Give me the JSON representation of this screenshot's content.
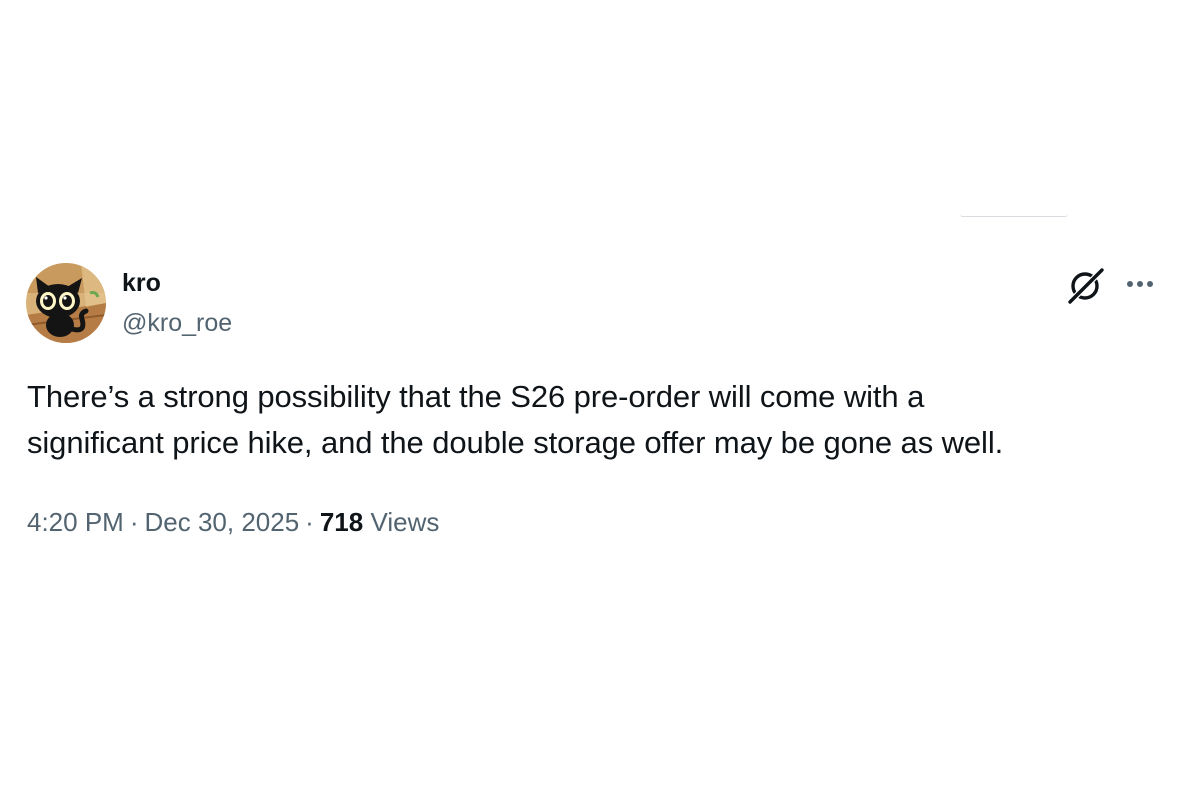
{
  "tweet": {
    "author": {
      "display_name": "kro",
      "handle": "@kro_roe",
      "avatar_icon": "black-cat-avatar-icon"
    },
    "actions": {
      "grok_icon": "grok-icon",
      "more_icon": "more-dots-icon"
    },
    "text_lines": [
      "There’s a strong possibility that the S26 pre-order will come with a",
      "significant price hike, and the double storage offer may be gone as well."
    ],
    "meta": {
      "time": "4:20 PM",
      "separator": "·",
      "date": "Dec 30, 2025",
      "views_count": "718",
      "views_label": "Views"
    }
  },
  "colors": {
    "text_primary": "#0f1419",
    "text_secondary": "#536471",
    "background": "#ffffff"
  }
}
